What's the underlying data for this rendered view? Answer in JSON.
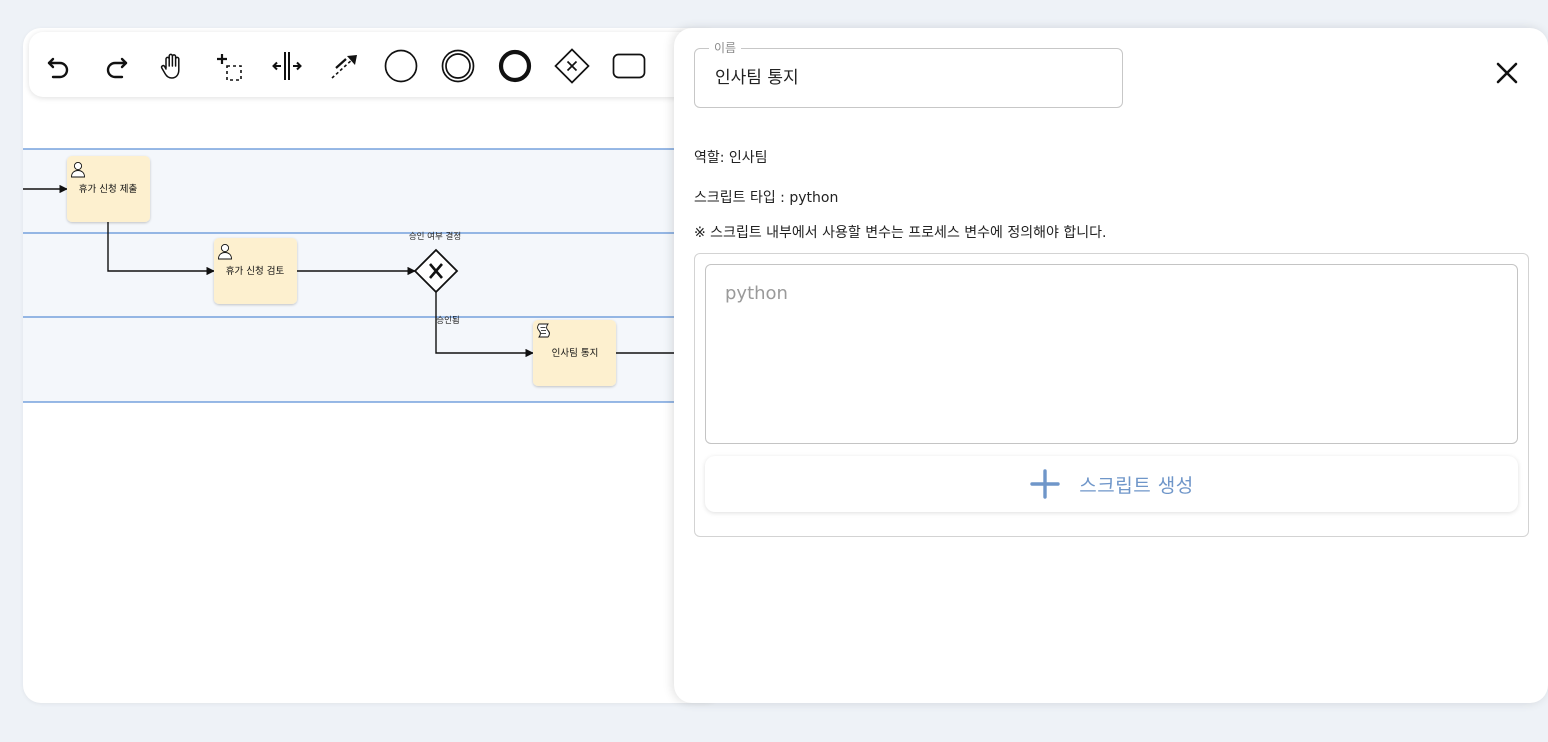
{
  "toolbar": {
    "tools": [
      "undo-icon",
      "redo-icon",
      "hand-tool-icon",
      "lasso-tool-icon",
      "space-tool-icon",
      "connect-tool-icon",
      "start-event-icon",
      "intermediate-event-icon",
      "end-event-icon",
      "gateway-icon",
      "task-icon"
    ]
  },
  "diagram": {
    "tasks": [
      {
        "label": "휴가 신청 제출",
        "icon": "user-task-icon"
      },
      {
        "label": "휴가 신청 검토",
        "icon": "user-task-icon"
      },
      {
        "label": "인사팀 통지",
        "icon": "script-task-icon"
      }
    ],
    "gateway_label": "승인 여부 결정",
    "flow_label": "승인됨",
    "lane_color": "#5b8fd6",
    "task_fill": "#fdf0cf"
  },
  "panel": {
    "name_legend": "이름",
    "name_value": "인사팀 통지",
    "role_text": "역할: 인사팀",
    "script_type_text": "스크립트 타입 : python",
    "note_text": "※ 스크립트 내부에서 사용할 변수는 프로세스 변수에 정의해야 합니다.",
    "script_placeholder": "python",
    "generate_label": "스크립트 생성",
    "accent_color": "#6f96c9"
  }
}
